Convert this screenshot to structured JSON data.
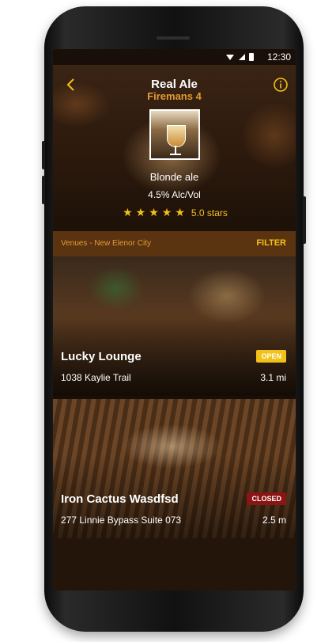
{
  "status": {
    "time": "12:30"
  },
  "header": {
    "title": "Real Ale",
    "subtitle": "Firemans 4"
  },
  "beer": {
    "style": "Blonde ale",
    "abv": "4.5% Alc/Vol",
    "stars": 5,
    "rating_text": "5.0 stars"
  },
  "filter_bar": {
    "location": "Venues - New Elenor City",
    "filter_label": "FILTER"
  },
  "venues": [
    {
      "name": "Lucky Lounge",
      "address": "1038 Kaylie Trail",
      "distance": "3.1 mi",
      "status": "OPEN"
    },
    {
      "name": "Iron Cactus Wasdfsd",
      "address": "277 Linnie Bypass Suite 073",
      "distance": "2.5 m",
      "status": "CLOSED"
    }
  ],
  "colors": {
    "accent": "#e39a34",
    "star": "#f2c21a",
    "open": "#f2c21a",
    "closed": "#8b1414"
  },
  "icons": {
    "back": "chevron-left",
    "info": "info-circle",
    "wifi": "wifi",
    "signal": "cell-signal",
    "battery": "battery"
  }
}
